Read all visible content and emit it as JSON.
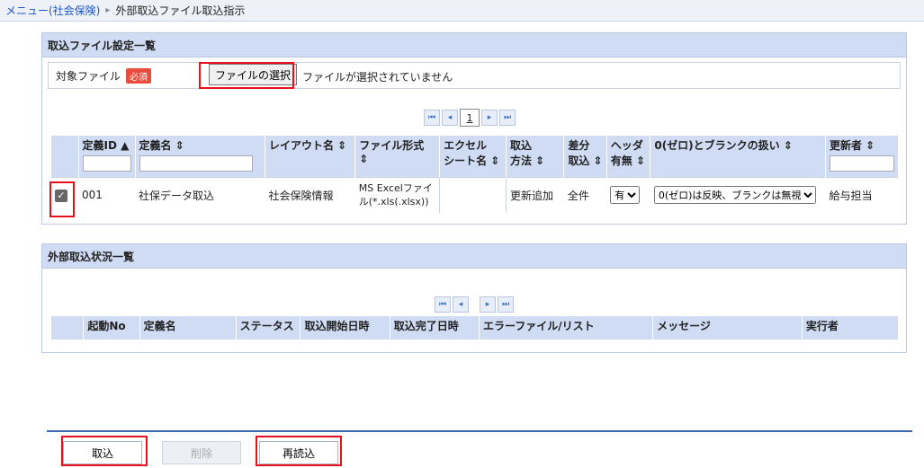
{
  "breadcrumb": {
    "menu": "メニュー(社会保険)",
    "current": "外部取込ファイル取込指示"
  },
  "settings": {
    "title": "取込ファイル設定一覧",
    "file_label": "対象ファイル",
    "required": "必須",
    "choose_file": "ファイルの選択",
    "file_status": "ファイルが選択されていません",
    "page": "1",
    "headers": {
      "id": "定義ID ▲",
      "name": "定義名 ⇕",
      "layout": "レイアウト名 ⇕",
      "format": "ファイル形式 ⇕",
      "sheet1": "エクセル",
      "sheet2": "シート名 ⇕",
      "method1": "取込",
      "method2": "方法 ⇕",
      "diff1": "差分",
      "diff2": "取込 ⇕",
      "header1": "ヘッダ",
      "header2": "有無 ⇕",
      "zero": "0(ゼロ)とブランクの扱い ⇕",
      "updater": "更新者 ⇕"
    },
    "row": {
      "id": "001",
      "name": "社保データ取込",
      "layout": "社会保険情報",
      "format1": "MS Excelファイ",
      "format2": "ル(*.xls(.xlsx))",
      "sheet": "",
      "method": "更新追加",
      "diff": "全件",
      "header": "有",
      "zero": "0(ゼロ)は反映、ブランクは無視",
      "updater": "給与担当"
    }
  },
  "status": {
    "title": "外部取込状況一覧",
    "headers": [
      "起動No",
      "定義名",
      "ステータス",
      "取込開始日時",
      "取込完了日時",
      "エラーファイル/リスト",
      "メッセージ",
      "実行者"
    ]
  },
  "buttons": {
    "import": "取込",
    "delete": "削除",
    "reload": "再読込"
  }
}
